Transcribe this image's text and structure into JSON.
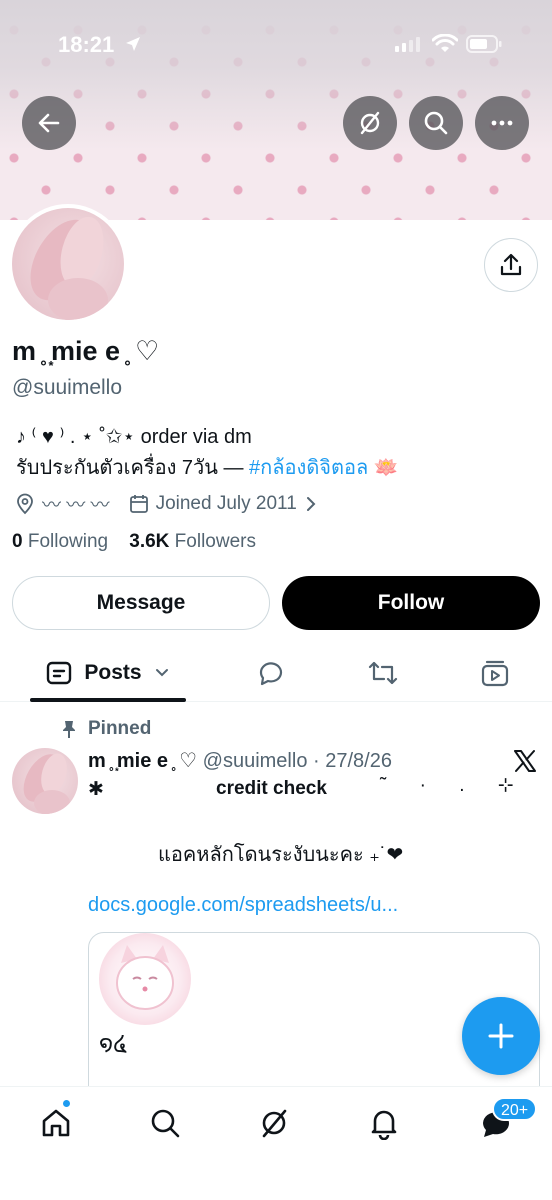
{
  "status_bar": {
    "time": "18:21"
  },
  "profile": {
    "display_name": "m ̥ ͙mie e ̥ ♡",
    "handle": "@suuimello",
    "bio_line1": "♪ ⁽ ♥︎ ⁾ . ⋆ ˚✩⋆ order via dm",
    "bio_line2_text": "รับประกันตัวเครื่อง 7วัน — ",
    "bio_line2_hashtag": "#กล้องดิจิตอล",
    "bio_line2_emoji": "🪷",
    "location": "〰︎ 〰︎ 〰︎",
    "joined": "Joined July 2011",
    "following_count": "0",
    "following_label": "Following",
    "followers_count": "3.6K",
    "followers_label": "Followers"
  },
  "actions": {
    "message_label": "Message",
    "follow_label": "Follow"
  },
  "tabs": {
    "posts_label": "Posts"
  },
  "post": {
    "pinned_label": "Pinned",
    "name": "m ̥ ͙mie e ̥ ♡",
    "handle_date": "@suuimello · 27/8/26",
    "star": "✱",
    "credit": "credit check",
    "deco": "˜ · . ⊹",
    "line2": "แอคหลักโดนระงับนะคะ ₊˙❤",
    "link": "docs.google.com/spreadsheets/u...",
    "card_text": "໑໔"
  },
  "nav": {
    "messages_badge": "20+"
  },
  "colors": {
    "accent": "#1d9bf0",
    "text": "#0f1419",
    "secondary": "#536471"
  }
}
